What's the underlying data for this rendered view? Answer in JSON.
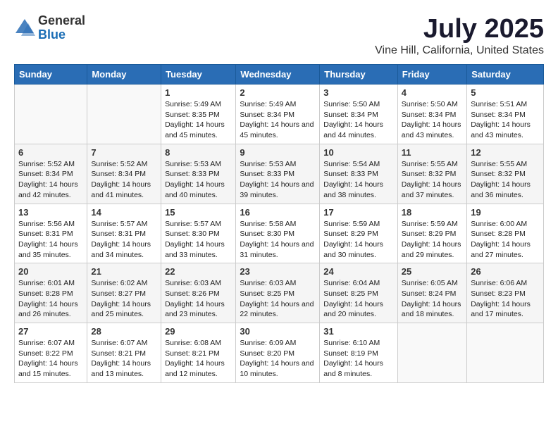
{
  "header": {
    "logo_general": "General",
    "logo_blue": "Blue",
    "main_title": "July 2025",
    "subtitle": "Vine Hill, California, United States"
  },
  "weekdays": [
    "Sunday",
    "Monday",
    "Tuesday",
    "Wednesday",
    "Thursday",
    "Friday",
    "Saturday"
  ],
  "weeks": [
    [
      {
        "day": "",
        "info": ""
      },
      {
        "day": "",
        "info": ""
      },
      {
        "day": "1",
        "info": "Sunrise: 5:49 AM\nSunset: 8:35 PM\nDaylight: 14 hours and 45 minutes."
      },
      {
        "day": "2",
        "info": "Sunrise: 5:49 AM\nSunset: 8:34 PM\nDaylight: 14 hours and 45 minutes."
      },
      {
        "day": "3",
        "info": "Sunrise: 5:50 AM\nSunset: 8:34 PM\nDaylight: 14 hours and 44 minutes."
      },
      {
        "day": "4",
        "info": "Sunrise: 5:50 AM\nSunset: 8:34 PM\nDaylight: 14 hours and 43 minutes."
      },
      {
        "day": "5",
        "info": "Sunrise: 5:51 AM\nSunset: 8:34 PM\nDaylight: 14 hours and 43 minutes."
      }
    ],
    [
      {
        "day": "6",
        "info": "Sunrise: 5:52 AM\nSunset: 8:34 PM\nDaylight: 14 hours and 42 minutes."
      },
      {
        "day": "7",
        "info": "Sunrise: 5:52 AM\nSunset: 8:34 PM\nDaylight: 14 hours and 41 minutes."
      },
      {
        "day": "8",
        "info": "Sunrise: 5:53 AM\nSunset: 8:33 PM\nDaylight: 14 hours and 40 minutes."
      },
      {
        "day": "9",
        "info": "Sunrise: 5:53 AM\nSunset: 8:33 PM\nDaylight: 14 hours and 39 minutes."
      },
      {
        "day": "10",
        "info": "Sunrise: 5:54 AM\nSunset: 8:33 PM\nDaylight: 14 hours and 38 minutes."
      },
      {
        "day": "11",
        "info": "Sunrise: 5:55 AM\nSunset: 8:32 PM\nDaylight: 14 hours and 37 minutes."
      },
      {
        "day": "12",
        "info": "Sunrise: 5:55 AM\nSunset: 8:32 PM\nDaylight: 14 hours and 36 minutes."
      }
    ],
    [
      {
        "day": "13",
        "info": "Sunrise: 5:56 AM\nSunset: 8:31 PM\nDaylight: 14 hours and 35 minutes."
      },
      {
        "day": "14",
        "info": "Sunrise: 5:57 AM\nSunset: 8:31 PM\nDaylight: 14 hours and 34 minutes."
      },
      {
        "day": "15",
        "info": "Sunrise: 5:57 AM\nSunset: 8:30 PM\nDaylight: 14 hours and 33 minutes."
      },
      {
        "day": "16",
        "info": "Sunrise: 5:58 AM\nSunset: 8:30 PM\nDaylight: 14 hours and 31 minutes."
      },
      {
        "day": "17",
        "info": "Sunrise: 5:59 AM\nSunset: 8:29 PM\nDaylight: 14 hours and 30 minutes."
      },
      {
        "day": "18",
        "info": "Sunrise: 5:59 AM\nSunset: 8:29 PM\nDaylight: 14 hours and 29 minutes."
      },
      {
        "day": "19",
        "info": "Sunrise: 6:00 AM\nSunset: 8:28 PM\nDaylight: 14 hours and 27 minutes."
      }
    ],
    [
      {
        "day": "20",
        "info": "Sunrise: 6:01 AM\nSunset: 8:28 PM\nDaylight: 14 hours and 26 minutes."
      },
      {
        "day": "21",
        "info": "Sunrise: 6:02 AM\nSunset: 8:27 PM\nDaylight: 14 hours and 25 minutes."
      },
      {
        "day": "22",
        "info": "Sunrise: 6:03 AM\nSunset: 8:26 PM\nDaylight: 14 hours and 23 minutes."
      },
      {
        "day": "23",
        "info": "Sunrise: 6:03 AM\nSunset: 8:25 PM\nDaylight: 14 hours and 22 minutes."
      },
      {
        "day": "24",
        "info": "Sunrise: 6:04 AM\nSunset: 8:25 PM\nDaylight: 14 hours and 20 minutes."
      },
      {
        "day": "25",
        "info": "Sunrise: 6:05 AM\nSunset: 8:24 PM\nDaylight: 14 hours and 18 minutes."
      },
      {
        "day": "26",
        "info": "Sunrise: 6:06 AM\nSunset: 8:23 PM\nDaylight: 14 hours and 17 minutes."
      }
    ],
    [
      {
        "day": "27",
        "info": "Sunrise: 6:07 AM\nSunset: 8:22 PM\nDaylight: 14 hours and 15 minutes."
      },
      {
        "day": "28",
        "info": "Sunrise: 6:07 AM\nSunset: 8:21 PM\nDaylight: 14 hours and 13 minutes."
      },
      {
        "day": "29",
        "info": "Sunrise: 6:08 AM\nSunset: 8:21 PM\nDaylight: 14 hours and 12 minutes."
      },
      {
        "day": "30",
        "info": "Sunrise: 6:09 AM\nSunset: 8:20 PM\nDaylight: 14 hours and 10 minutes."
      },
      {
        "day": "31",
        "info": "Sunrise: 6:10 AM\nSunset: 8:19 PM\nDaylight: 14 hours and 8 minutes."
      },
      {
        "day": "",
        "info": ""
      },
      {
        "day": "",
        "info": ""
      }
    ]
  ]
}
